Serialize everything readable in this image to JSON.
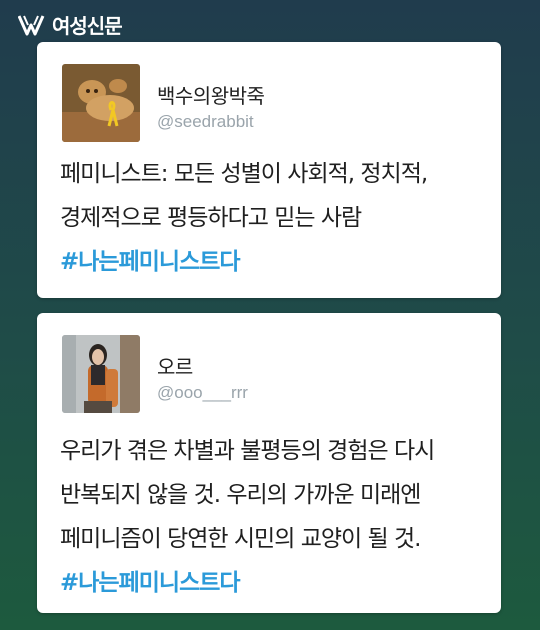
{
  "header": {
    "brand": "여성신문"
  },
  "tweets": [
    {
      "name": "백수의왕박죽",
      "handle": "@seedrabbit",
      "lines": [
        "페미니스트: 모든 성별이 사회적, 정치적,",
        "경제적으로 평등하다고 믿는 사람"
      ],
      "hashtag": "#나는페미니스트다",
      "avatar_icon": "lion-cub-avatar"
    },
    {
      "name": "오르",
      "handle": "@ooo___rrr",
      "lines": [
        "우리가 겪은 차별과 불평등의 경험은 다시",
        "반복되지 않을 것. 우리의 가까운 미래엔",
        "페미니즘이 당연한 시민의 교양이 될 것."
      ],
      "hashtag": "#나는페미니스트다",
      "avatar_icon": "person-photo-avatar"
    }
  ],
  "colors": {
    "hashtag": "#2b9ad9",
    "background_top": "#203c4d",
    "background_bottom": "#1d5a3e"
  }
}
